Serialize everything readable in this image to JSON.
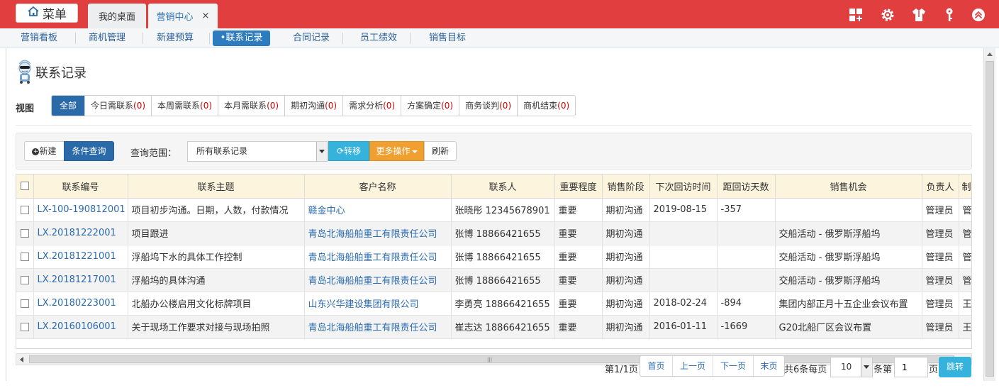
{
  "topbar": {
    "menu_label": "菜单",
    "tabs": [
      {
        "label": "我的桌面"
      },
      {
        "label": "营销中心",
        "close": "×"
      }
    ],
    "icons": [
      "grid-add-icon",
      "gear-icon",
      "shirt-icon",
      "key-icon",
      "chevron-up-icon"
    ]
  },
  "subnav": [
    {
      "label": "营销看板"
    },
    {
      "label": "商机管理"
    },
    {
      "label": "新建预算"
    },
    {
      "label": "•联系记录",
      "active": true
    },
    {
      "label": "合同记录"
    },
    {
      "label": "员工绩效"
    },
    {
      "label": "销售目标"
    }
  ],
  "page": {
    "title": "联系记录"
  },
  "view": {
    "label": "视图",
    "filters": [
      {
        "label": "全部",
        "count": ""
      },
      {
        "label": "今日需联系",
        "count": "(0)"
      },
      {
        "label": "本周需联系",
        "count": "(0)"
      },
      {
        "label": "本月需联系",
        "count": "(0)"
      },
      {
        "label": "期初沟通",
        "count": "(0)"
      },
      {
        "label": "需求分析",
        "count": "(0)"
      },
      {
        "label": "方案确定",
        "count": "(0)"
      },
      {
        "label": "商务谈判",
        "count": "(0)"
      },
      {
        "label": "商机结束",
        "count": "(0)"
      }
    ]
  },
  "toolbar": {
    "new_label": "新建",
    "query_label": "条件查询",
    "range_label": "查询范围：",
    "range_value": "所有联系记录",
    "transfer_label": "转移",
    "more_label": "更多操作",
    "refresh_label": "刷新"
  },
  "table": {
    "columns": [
      "联系编号",
      "联系主题",
      "客户名称",
      "联系人",
      "重要程度",
      "销售阶段",
      "下次回访时间",
      "距回访天数",
      "销售机会",
      "负责人",
      "制"
    ],
    "rows": [
      {
        "id": "LX-100-190812001",
        "subject": "项目初步沟通。日期，人数，付款情况",
        "customer": "赣金中心",
        "contact": "张晓彤 12345678901",
        "importance": "重要",
        "stage": "期初沟通",
        "next_visit": "2019-08-15",
        "days": "-357",
        "opportunity": "",
        "owner": "管理员",
        "creator": "管"
      },
      {
        "id": "LX.20181222001",
        "subject": "项目跟进",
        "customer": "青岛北海船舶重工有限责任公司",
        "contact": "张博 18866421655",
        "importance": "重要",
        "stage": "期初沟通",
        "next_visit": "",
        "days": "",
        "opportunity": "交船活动 - 俄罗斯浮船坞",
        "owner": "管理员",
        "creator": "管"
      },
      {
        "id": "LX.20181221001",
        "subject": "浮船坞下水的具体工作控制",
        "customer": "青岛北海船舶重工有限责任公司",
        "contact": "张博 18866421655",
        "importance": "重要",
        "stage": "期初沟通",
        "next_visit": "",
        "days": "",
        "opportunity": "交船活动 - 俄罗斯浮船坞",
        "owner": "管理员",
        "creator": "管"
      },
      {
        "id": "LX.20181217001",
        "subject": "浮船坞的具体沟通",
        "customer": "青岛北海船舶重工有限责任公司",
        "contact": "张博 18866421655",
        "importance": "重要",
        "stage": "期初沟通",
        "next_visit": "",
        "days": "",
        "opportunity": "交船活动 - 俄罗斯浮船坞",
        "owner": "管理员",
        "creator": "管"
      },
      {
        "id": "LX.20180223001",
        "subject": "北船办公楼启用文化标牌项目",
        "customer": "山东兴华建设集团有限公司",
        "contact": "李勇亮 18866421655",
        "importance": "重要",
        "stage": "期初沟通",
        "next_visit": "2018-02-24",
        "days": "-894",
        "opportunity": "集团内部正月十五企业会议布置",
        "owner": "管理员",
        "creator": "王"
      },
      {
        "id": "LX.20160106001",
        "subject": "关于现场工作要求对接与现场拍照",
        "customer": "青岛北海船舶重工有限责任公司",
        "contact": "崔志达 18866421655",
        "importance": "重要",
        "stage": "期初沟通",
        "next_visit": "2016-01-11",
        "days": "-1669",
        "opportunity": "G20北船厂区会议布置",
        "owner": "管理员",
        "creator": "王"
      }
    ]
  },
  "pager": {
    "page_info": "第1/1页",
    "first": "首页",
    "prev": "上一页",
    "next": "下一页",
    "last": "末页",
    "total": "共6条每页",
    "page_size": "10",
    "unit": "条第",
    "page_input": "1",
    "page_suffix": "页",
    "go": "跳转"
  },
  "colors": {
    "header_red": "#e13f3f",
    "accent_blue": "#2a6aa8",
    "link_blue": "#2b6cb0",
    "orange": "#f0a030",
    "cyan": "#35b3dc"
  }
}
